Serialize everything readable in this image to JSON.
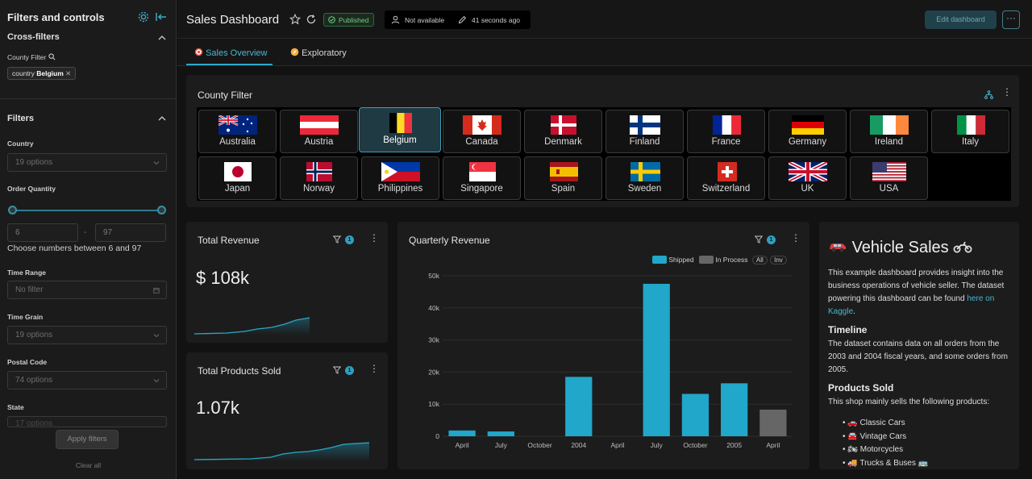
{
  "sidebar": {
    "title": "Filters and controls",
    "cross_filters_heading": "Cross-filters",
    "county_filter_label": "County Filter",
    "chip": {
      "prefix": "country",
      "value": "Belgium"
    },
    "filters_heading": "Filters",
    "country": {
      "label": "Country",
      "placeholder": "19 options"
    },
    "order_quantity": {
      "label": "Order Quantity",
      "min": "6",
      "max": "97",
      "hint": "Choose numbers between 6 and 97",
      "dash": "-"
    },
    "time_range": {
      "label": "Time Range",
      "placeholder": "No filter"
    },
    "time_grain": {
      "label": "Time Grain",
      "placeholder": "19 options"
    },
    "postal_code": {
      "label": "Postal Code",
      "placeholder": "74 options"
    },
    "state": {
      "label": "State",
      "placeholder": "17 options"
    },
    "apply_label": "Apply filters",
    "clear_label": "Clear all"
  },
  "header": {
    "title": "Sales Dashboard",
    "status": "Published",
    "owner": "Not available",
    "modified": "41 seconds ago",
    "edit_label": "Edit dashboard",
    "more_label": "···"
  },
  "tabs": [
    {
      "label": "Sales Overview",
      "active": true
    },
    {
      "label": "Exploratory",
      "active": false
    }
  ],
  "country_filter": {
    "title": "County Filter",
    "selected": "Belgium",
    "countries": [
      "Australia",
      "Austria",
      "Belgium",
      "Canada",
      "Denmark",
      "Finland",
      "France",
      "Germany",
      "Ireland",
      "Italy",
      "Japan",
      "Norway",
      "Philippines",
      "Singapore",
      "Spain",
      "Sweden",
      "Switzerland",
      "UK",
      "USA"
    ]
  },
  "total_revenue": {
    "title": "Total Revenue",
    "value": "$ 108k",
    "filter_count": "1"
  },
  "total_products": {
    "title": "Total Products Sold",
    "value": "1.07k",
    "filter_count": "1"
  },
  "quarterly_revenue": {
    "title": "Quarterly Revenue",
    "filter_count": "1",
    "legend_all": "All",
    "legend_inv": "Inv"
  },
  "chart_data": {
    "type": "bar",
    "title": "Quarterly Revenue",
    "categories": [
      "April",
      "July",
      "October",
      "2004",
      "April",
      "July",
      "October",
      "2005",
      "April"
    ],
    "series": [
      {
        "name": "Shipped",
        "color": "#20a7c9",
        "values": [
          1800,
          1500,
          0,
          18500,
          0,
          47500,
          13200,
          16500,
          0
        ]
      },
      {
        "name": "In Process",
        "color": "#666666",
        "values": [
          0,
          0,
          0,
          0,
          0,
          0,
          0,
          0,
          8300
        ]
      }
    ],
    "yticks": [
      "0",
      "10k",
      "20k",
      "30k",
      "40k",
      "50k"
    ],
    "ylim": [
      0,
      50000
    ],
    "grid": true,
    "legend_position": "top-right"
  },
  "markdown": {
    "title": "Vehicle Sales",
    "intro": "This example dashboard provides insight into the business operations of vehicle seller. The dataset powering this dashboard can be found",
    "link": "here on Kaggle",
    "period": ".",
    "timeline_heading": "Timeline",
    "timeline_text": "The dataset contains data on all orders from the 2003 and 2004 fiscal years, and some orders from 2005.",
    "products_heading": "Products Sold",
    "products_text": "This shop mainly sells the following products:",
    "products": [
      "Classic Cars",
      "Vintage Cars",
      "Motorcycles",
      "Trucks & Buses"
    ]
  },
  "colors": {
    "accent": "#2ea8c9",
    "background": "#121212",
    "card": "#1c1c1c"
  },
  "icons": [
    "gear-icon",
    "collapse-icon",
    "search-icon",
    "chevron-up-icon",
    "chevron-down-icon",
    "calendar-icon",
    "star-icon",
    "refresh-icon",
    "user-icon",
    "pencil-icon",
    "target-icon",
    "compass-icon",
    "hierarchy-icon",
    "filter-icon",
    "car-icon",
    "motorcycle-icon",
    "bus-icon"
  ]
}
